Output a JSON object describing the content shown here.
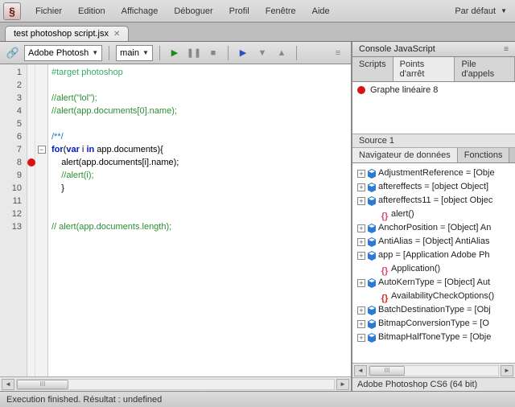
{
  "menu": {
    "items": [
      "Fichier",
      "Edition",
      "Affichage",
      "Déboguer",
      "Profil",
      "Fenêtre",
      "Aide"
    ],
    "profile_label": "Par défaut"
  },
  "app_icon_glyph": "§",
  "tabs": {
    "file_name": "test photoshop script.jsx"
  },
  "toolbar": {
    "target_app": "Adobe Photosh",
    "target_fn": "main"
  },
  "editor": {
    "lines": [
      {
        "n": 1,
        "seg": [
          {
            "c": "c-directive",
            "t": "#target photoshop"
          }
        ]
      },
      {
        "n": 2,
        "seg": []
      },
      {
        "n": 3,
        "seg": [
          {
            "c": "c-comment",
            "t": "//alert(\"lol\");"
          }
        ]
      },
      {
        "n": 4,
        "seg": [
          {
            "c": "c-comment",
            "t": "//alert(app.documents[0].name);"
          }
        ]
      },
      {
        "n": 5,
        "seg": []
      },
      {
        "n": 6,
        "seg": [
          {
            "c": "c-doccomment",
            "t": "/**/"
          }
        ]
      },
      {
        "n": 7,
        "fold": true,
        "seg": [
          {
            "c": "c-kw",
            "t": "for"
          },
          {
            "c": "c-plain",
            "t": "("
          },
          {
            "c": "c-kw",
            "t": "var"
          },
          {
            "c": "c-plain",
            "t": " i "
          },
          {
            "c": "c-kw",
            "t": "in"
          },
          {
            "c": "c-plain",
            "t": " app.documents){"
          }
        ]
      },
      {
        "n": 8,
        "bp": true,
        "seg": [
          {
            "c": "c-plain",
            "t": "    alert(app.documents[i].name);"
          }
        ]
      },
      {
        "n": 9,
        "seg": [
          {
            "c": "c-comment",
            "t": "    //alert(i);"
          }
        ]
      },
      {
        "n": 10,
        "seg": [
          {
            "c": "c-plain",
            "t": "    }"
          }
        ]
      },
      {
        "n": 11,
        "seg": []
      },
      {
        "n": 12,
        "seg": []
      },
      {
        "n": 13,
        "seg": [
          {
            "c": "c-comment",
            "t": "// alert(app.documents.length);"
          }
        ]
      }
    ]
  },
  "statusbar": {
    "text": "Execution finished. Résultat : undefined"
  },
  "right": {
    "console_title": "Console JavaScript",
    "tabs1": [
      "Scripts",
      "Points d'arrêt",
      "Pile d'appels"
    ],
    "active_tab1": 1,
    "breakpoints": [
      {
        "label": "Graphe linéaire 8"
      }
    ],
    "source_label": "Source 1",
    "tabs2": [
      "Navigateur de données",
      "Fonctions"
    ],
    "active_tab2": 0,
    "tree": [
      {
        "plus": true,
        "icon": "cube",
        "text": "AdjustmentReference = [Obje"
      },
      {
        "plus": true,
        "icon": "cube",
        "text": "aftereffects = [object Object]"
      },
      {
        "plus": true,
        "icon": "cube",
        "text": "aftereffects11 = [object Objec"
      },
      {
        "plus": false,
        "icon": "brace",
        "text": "alert()",
        "indent": true
      },
      {
        "plus": true,
        "icon": "cube",
        "text": "AnchorPosition = [Object] An"
      },
      {
        "plus": true,
        "icon": "cube",
        "text": "AntiAlias = [Object] AntiAlias"
      },
      {
        "plus": true,
        "icon": "cube",
        "text": "app = [Application Adobe Ph"
      },
      {
        "plus": false,
        "icon": "brace",
        "text": "Application()",
        "indent": true
      },
      {
        "plus": true,
        "icon": "cube",
        "text": "AutoKernType = [Object] Aut"
      },
      {
        "plus": false,
        "icon": "brace-red",
        "text": "AvailabilityCheckOptions()",
        "indent": true
      },
      {
        "plus": true,
        "icon": "cube",
        "text": "BatchDestinationType = [Obj"
      },
      {
        "plus": true,
        "icon": "cube",
        "text": "BitmapConversionType = [O"
      },
      {
        "plus": true,
        "icon": "cube",
        "text": "BitmapHalfToneType = [Obje"
      }
    ],
    "footer": "Adobe Photoshop CS6 (64 bit)"
  },
  "hscroll_thumb_label": "III"
}
